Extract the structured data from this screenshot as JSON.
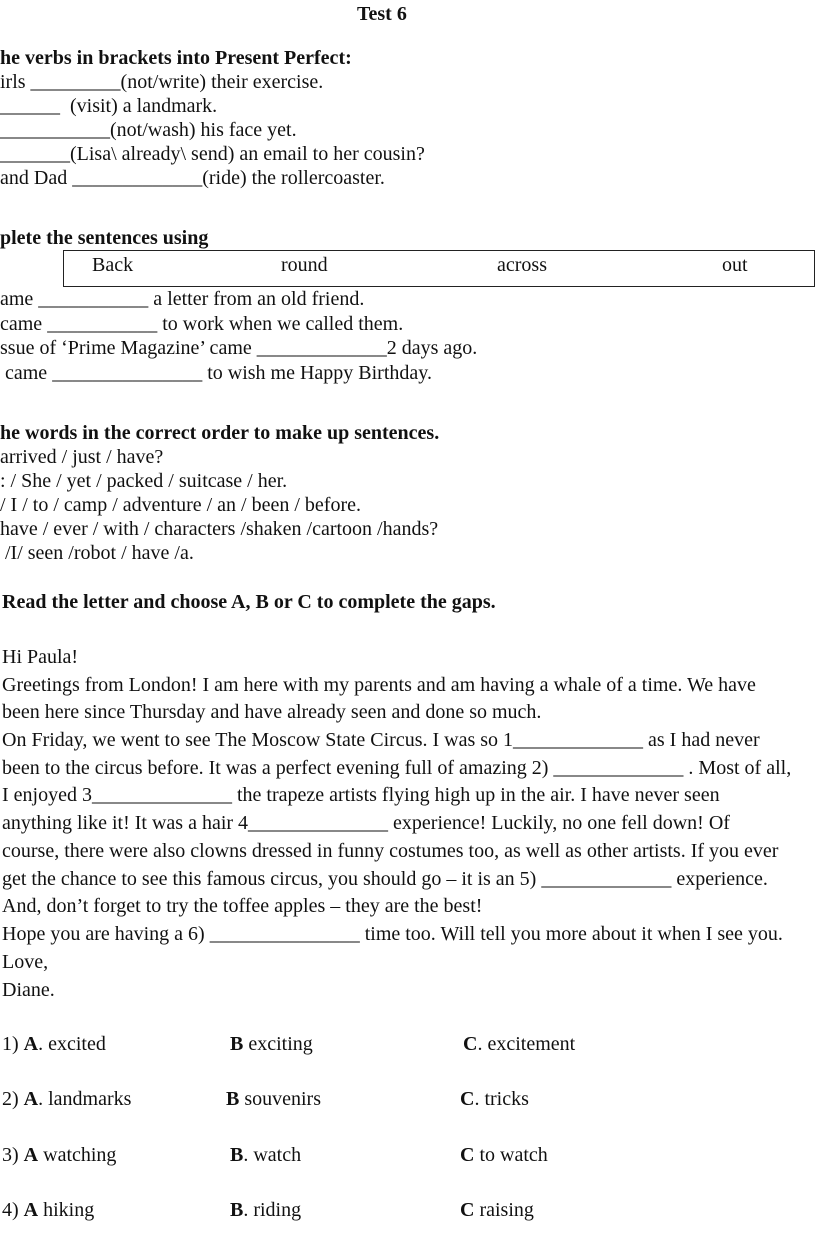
{
  "title": "Test 6",
  "section1": {
    "heading": "he verbs in brackets into Present Perfect:",
    "lines": [
      "irls _________(not/write) their exercise.",
      "______  (visit) a landmark.",
      "___________(not/wash) his face yet.",
      "_______(Lisa\\ already\\ send) an email to her cousin?",
      "and Dad _____________(ride) the rollercoaster."
    ]
  },
  "section2": {
    "heading": "plete the sentences using",
    "words": [
      "Back",
      "round",
      "across",
      "out"
    ],
    "lines": [
      "ame ___________ a letter from an old friend.",
      "came ___________ to work when we called them.",
      "ssue of ‘Prime Magazine’ came _____________2 days ago.",
      " came _______________ to wish me Happy Birthday."
    ]
  },
  "section3": {
    "heading": "he words in the correct order to make up sentences.",
    "lines": [
      "arrived / just / have?",
      ": / She / yet / packed / suitcase / her.",
      "/ I / to / camp / adventure / an / been / before.",
      "have / ever / with / characters /shaken /cartoon /hands?",
      " /I/ seen /robot / have /a."
    ]
  },
  "section4": {
    "heading": "Read the letter and choose A, B or C to complete the gaps.",
    "letter": [
      "Hi Paula!",
      "Greetings from London! I am here with my parents and am having a whale of a time. We have",
      "been here since Thursday and have already seen and done so much.",
      "On Friday, we went to see The Moscow State Circus. I was so 1_____________ as I had never",
      "been to the circus before. It was a perfect evening full of amazing 2) _____________ . Most of all,",
      "I enjoyed 3______________ the trapeze artists flying high up in the air. I have never seen",
      "anything like it! It was a hair 4______________ experience! Luckily, no one fell down! Of",
      "course, there were also clowns dressed in funny costumes too, as well as other artists. If you ever",
      "get the chance to see this famous circus, you should go – it is an 5) _____________ experience.",
      "And, don’t forget to try the toffee apples – they are the best!",
      "Hope you are having a 6) _______________ time too. Will tell you more about it when I see you.",
      "Love,",
      "Diane."
    ],
    "options": [
      {
        "num": "1) ",
        "a": ". excited",
        "b": " exciting",
        "c": ". excitement"
      },
      {
        "num": "2) ",
        "a": ". landmarks",
        "b": " souvenirs",
        "c": ". tricks"
      },
      {
        "num": "3) ",
        "a": " watching",
        "b": ". watch",
        "c": " to watch"
      },
      {
        "num": "4) ",
        "a": " hiking",
        "b": ". riding",
        "c": " raising"
      }
    ],
    "letters": {
      "a": "A",
      "b": "B",
      "c": "C"
    }
  }
}
